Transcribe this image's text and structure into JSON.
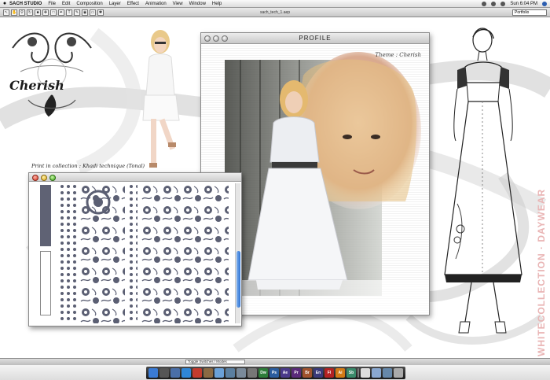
{
  "menubar": {
    "app_name": "SACH STUDIO",
    "menus": [
      "File",
      "Edit",
      "Composition",
      "Layer",
      "Effect",
      "Animation",
      "View",
      "Window",
      "Help"
    ],
    "clock": "Sun 6:04 PM"
  },
  "toolbar": {
    "document_title": "sach_tech_1.aep",
    "preset": "Portfolio"
  },
  "canvas": {
    "logo_text": "Cherish",
    "caption": "Print in collection : Khadi technique (Tonal)",
    "vertical_text": "WHITECOLLECTION · DAYWEAR"
  },
  "profile_window": {
    "title": "PROFILE",
    "theme_label": "Theme : Cherish"
  },
  "statusbar": {
    "field": "Toggle Switches / Modes"
  },
  "dock": {
    "icons": [
      {
        "name": "finder-icon",
        "label": "",
        "color": "#3a7bd5"
      },
      {
        "name": "dashboard-icon",
        "label": "",
        "color": "#555555"
      },
      {
        "name": "mail-icon",
        "label": "",
        "color": "#4a6fa8"
      },
      {
        "name": "safari-icon",
        "label": "",
        "color": "#2f86d6"
      },
      {
        "name": "ical-icon",
        "label": "",
        "color": "#c33b2d"
      },
      {
        "name": "addressbook-icon",
        "label": "",
        "color": "#8a6a43"
      },
      {
        "name": "itunes-icon",
        "label": "",
        "color": "#6aa1d8"
      },
      {
        "name": "iphoto-icon",
        "label": "",
        "color": "#5a7fa0"
      },
      {
        "name": "preview-icon",
        "label": "",
        "color": "#7a8a9a"
      },
      {
        "name": "preferences-icon",
        "label": "",
        "color": "#777777"
      },
      {
        "name": "dreamweaver-icon",
        "label": "Dw",
        "color": "#2e7d3a"
      },
      {
        "name": "photoshop-icon",
        "label": "Ps",
        "color": "#2a5d9e"
      },
      {
        "name": "aftereffects-icon",
        "label": "Ae",
        "color": "#4a3a8a"
      },
      {
        "name": "premiere-icon",
        "label": "Pr",
        "color": "#5a2a7a"
      },
      {
        "name": "bridge-icon",
        "label": "Br",
        "color": "#a0522d"
      },
      {
        "name": "encore-icon",
        "label": "En",
        "color": "#3a3a7a"
      },
      {
        "name": "flash-icon",
        "label": "Fl",
        "color": "#b22222"
      },
      {
        "name": "illustrator-icon",
        "label": "Ai",
        "color": "#d17a16"
      },
      {
        "name": "soundbooth-icon",
        "label": "Sb",
        "color": "#3a8a6a"
      },
      {
        "name": "spacer",
        "label": "",
        "color": "#1b1b1b"
      },
      {
        "name": "document-icon",
        "label": "",
        "color": "#dddddd"
      },
      {
        "name": "folder-icon",
        "label": "",
        "color": "#8aa8d0"
      },
      {
        "name": "downloads-icon",
        "label": "",
        "color": "#6688aa"
      },
      {
        "name": "trash-icon",
        "label": "",
        "color": "#aaaaaa"
      }
    ]
  }
}
